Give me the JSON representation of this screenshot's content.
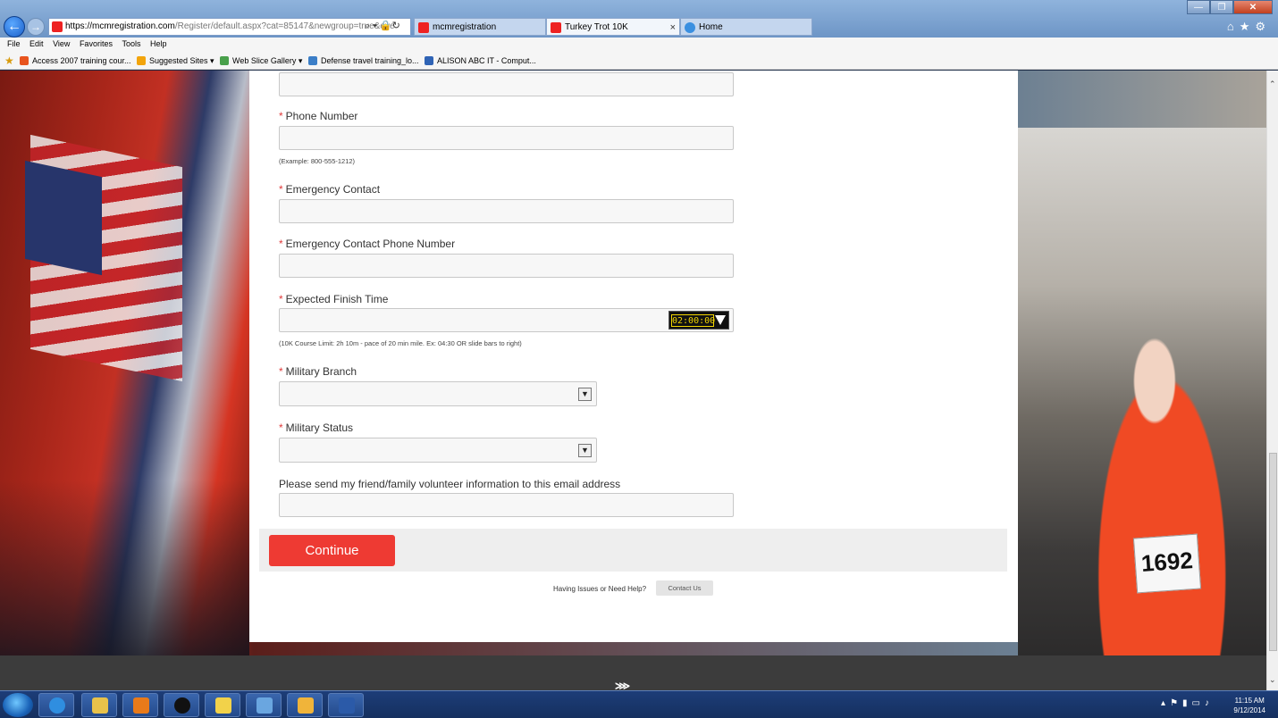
{
  "browser": {
    "url_host": "https://mcmregistration.com",
    "url_path": "/Register/default.aspx?cat=85147&newgroup=true&eve",
    "tabs": [
      {
        "label": "mcmregistration"
      },
      {
        "label": "Turkey Trot 10K"
      },
      {
        "label": "Home"
      }
    ],
    "tab_close": "×",
    "menu": [
      "File",
      "Edit",
      "View",
      "Favorites",
      "Tools",
      "Help"
    ],
    "favorites": [
      {
        "label": "Access 2007 training cour...",
        "color": "#e8541e"
      },
      {
        "label": "Suggested Sites ▾",
        "color": "#f2a40c"
      },
      {
        "label": "Web Slice Gallery ▾",
        "color": "#49a04b"
      },
      {
        "label": "Defense travel training_lo...",
        "color": "#3b7ec7"
      },
      {
        "label": "ALISON ABC IT - Comput...",
        "color": "#2f63b5"
      }
    ]
  },
  "form": {
    "phone_label": "Phone Number",
    "phone_hint": "(Example: 800-555-1212)",
    "emergency_contact_label": "Emergency Contact",
    "emergency_phone_label": "Emergency Contact Phone Number",
    "finish_time_label": "Expected Finish Time",
    "finish_time_value": "02:00:00",
    "finish_time_hint": "(10K Course Limit: 2h 10m - pace of 20 min mile. Ex: 04:30 OR slide bars to right)",
    "military_branch_label": "Military Branch",
    "military_status_label": "Military Status",
    "volunteer_email_label": "Please send my friend/family volunteer information to this email address",
    "required_marker": "*",
    "continue_label": "Continue",
    "help_text": "Having Issues or Need Help?",
    "contact_label": "Contact Us"
  },
  "background": {
    "bib_number": "1692"
  },
  "taskbar": {
    "time": "11:15 AM",
    "date": "9/12/2014"
  },
  "colors": {
    "accent": "#ee3a33",
    "required": "#e03a3a"
  }
}
